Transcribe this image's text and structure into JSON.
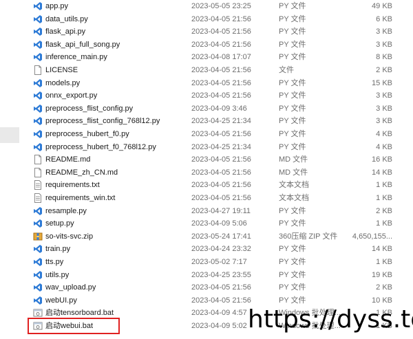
{
  "files": [
    {
      "name": "app.py",
      "date": "2023-05-05 23:25",
      "type": "PY 文件",
      "size": "49 KB",
      "icon": "python-file-icon"
    },
    {
      "name": "data_utils.py",
      "date": "2023-04-05 21:56",
      "type": "PY 文件",
      "size": "6 KB",
      "icon": "python-file-icon"
    },
    {
      "name": "flask_api.py",
      "date": "2023-04-05 21:56",
      "type": "PY 文件",
      "size": "3 KB",
      "icon": "python-file-icon"
    },
    {
      "name": "flask_api_full_song.py",
      "date": "2023-04-05 21:56",
      "type": "PY 文件",
      "size": "3 KB",
      "icon": "python-file-icon"
    },
    {
      "name": "inference_main.py",
      "date": "2023-04-08 17:07",
      "type": "PY 文件",
      "size": "8 KB",
      "icon": "python-file-icon"
    },
    {
      "name": "LICENSE",
      "date": "2023-04-05 21:56",
      "type": "文件",
      "size": "2 KB",
      "icon": "blank-file-icon"
    },
    {
      "name": "models.py",
      "date": "2023-04-05 21:56",
      "type": "PY 文件",
      "size": "15 KB",
      "icon": "python-file-icon"
    },
    {
      "name": "onnx_export.py",
      "date": "2023-04-05 21:56",
      "type": "PY 文件",
      "size": "3 KB",
      "icon": "python-file-icon"
    },
    {
      "name": "preprocess_flist_config.py",
      "date": "2023-04-09 3:46",
      "type": "PY 文件",
      "size": "3 KB",
      "icon": "python-file-icon"
    },
    {
      "name": "preprocess_flist_config_768l12.py",
      "date": "2023-04-25 21:34",
      "type": "PY 文件",
      "size": "3 KB",
      "icon": "python-file-icon"
    },
    {
      "name": "preprocess_hubert_f0.py",
      "date": "2023-04-05 21:56",
      "type": "PY 文件",
      "size": "4 KB",
      "icon": "python-file-icon"
    },
    {
      "name": "preprocess_hubert_f0_768l12.py",
      "date": "2023-04-25 21:34",
      "type": "PY 文件",
      "size": "4 KB",
      "icon": "python-file-icon"
    },
    {
      "name": "README.md",
      "date": "2023-04-05 21:56",
      "type": "MD 文件",
      "size": "16 KB",
      "icon": "blank-file-icon"
    },
    {
      "name": "README_zh_CN.md",
      "date": "2023-04-05 21:56",
      "type": "MD 文件",
      "size": "14 KB",
      "icon": "blank-file-icon"
    },
    {
      "name": "requirements.txt",
      "date": "2023-04-05 21:56",
      "type": "文本文档",
      "size": "1 KB",
      "icon": "text-file-icon"
    },
    {
      "name": "requirements_win.txt",
      "date": "2023-04-05 21:56",
      "type": "文本文档",
      "size": "1 KB",
      "icon": "text-file-icon"
    },
    {
      "name": "resample.py",
      "date": "2023-04-27 19:11",
      "type": "PY 文件",
      "size": "2 KB",
      "icon": "python-file-icon"
    },
    {
      "name": "setup.py",
      "date": "2023-04-09 5:06",
      "type": "PY 文件",
      "size": "1 KB",
      "icon": "python-file-icon"
    },
    {
      "name": "so-vits-svc.zip",
      "date": "2023-05-24 17:41",
      "type": "360压缩 ZIP 文件",
      "size": "4,650,155...",
      "icon": "zip-archive-icon"
    },
    {
      "name": "train.py",
      "date": "2023-04-24 23:32",
      "type": "PY 文件",
      "size": "14 KB",
      "icon": "python-file-icon"
    },
    {
      "name": "tts.py",
      "date": "2023-05-02 7:17",
      "type": "PY 文件",
      "size": "1 KB",
      "icon": "python-file-icon"
    },
    {
      "name": "utils.py",
      "date": "2023-04-25 23:55",
      "type": "PY 文件",
      "size": "19 KB",
      "icon": "python-file-icon"
    },
    {
      "name": "wav_upload.py",
      "date": "2023-04-05 21:56",
      "type": "PY 文件",
      "size": "2 KB",
      "icon": "python-file-icon"
    },
    {
      "name": "webUI.py",
      "date": "2023-04-05 21:56",
      "type": "PY 文件",
      "size": "10 KB",
      "icon": "python-file-icon"
    },
    {
      "name": "启动tensorboard.bat",
      "date": "2023-04-09 4:57",
      "type": "Windows 批处理...",
      "size": "1 KB",
      "icon": "batch-file-icon"
    },
    {
      "name": "启动webui.bat",
      "date": "2023-04-09 5:02",
      "type": "Windows 批处理...",
      "size": "1 KB",
      "icon": "batch-file-icon"
    }
  ],
  "watermark": "https://dyss.top",
  "colors": {
    "python_blue": "#2e7bd6",
    "highlight_red": "#e02020",
    "meta_gray": "#6d6d6d"
  }
}
